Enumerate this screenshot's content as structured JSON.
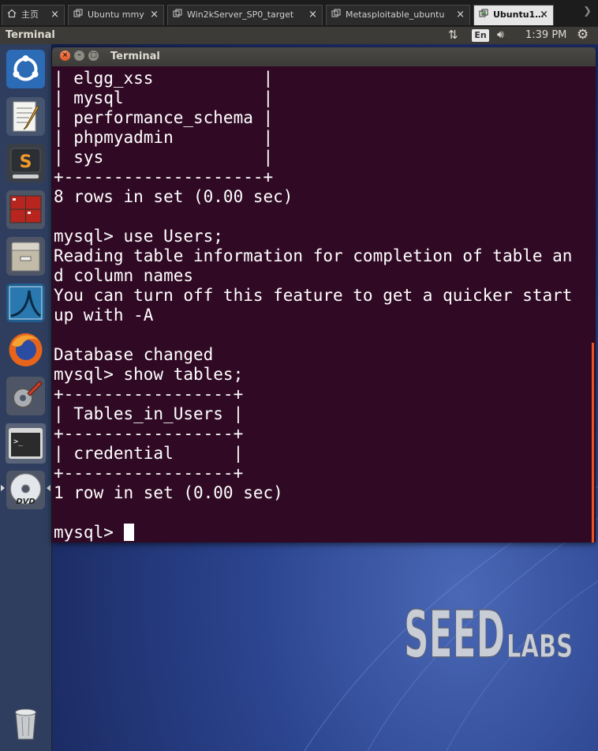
{
  "vm_tabs": [
    {
      "label": "主页",
      "icon": "home-icon",
      "active": false
    },
    {
      "label": "Ubuntu mmy",
      "icon": "vm-icon",
      "active": false
    },
    {
      "label": "Win2kServer_SP0_target",
      "icon": "vm-icon",
      "active": false
    },
    {
      "label": "Metasploitable_ubuntu",
      "icon": "vm-icon",
      "active": false
    },
    {
      "label": "Ubuntu1…",
      "icon": "vm-running-icon",
      "active": true
    }
  ],
  "panel": {
    "app_title": "Terminal",
    "language": "En",
    "clock": "1:39 PM"
  },
  "launcher": [
    "ubuntu-dash-icon",
    "text-editor-icon",
    "sublime-text-icon",
    "terminal-emulator-icon",
    "file-manager-icon",
    "wireshark-icon",
    "firefox-icon",
    "system-settings-icon",
    "terminal-icon",
    "dvd-icon",
    "trash-icon"
  ],
  "terminal": {
    "title": "Terminal",
    "lines": [
      "| elgg_xss           |",
      "| mysql              |",
      "| performance_schema |",
      "| phpmyadmin         |",
      "| sys                |",
      "+--------------------+",
      "8 rows in set (0.00 sec)",
      "",
      "mysql> use Users;",
      "Reading table information for completion of table an",
      "d column names",
      "You can turn off this feature to get a quicker start",
      "up with -A",
      "",
      "Database changed",
      "mysql> show tables;",
      "+-----------------+",
      "| Tables_in_Users |",
      "+-----------------+",
      "| credential      |",
      "+-----------------+",
      "1 row in set (0.00 sec)",
      ""
    ],
    "prompt": "mysql> "
  },
  "wallpaper": {
    "logo_text_main": "SEED",
    "logo_text_sub": "LABS"
  }
}
